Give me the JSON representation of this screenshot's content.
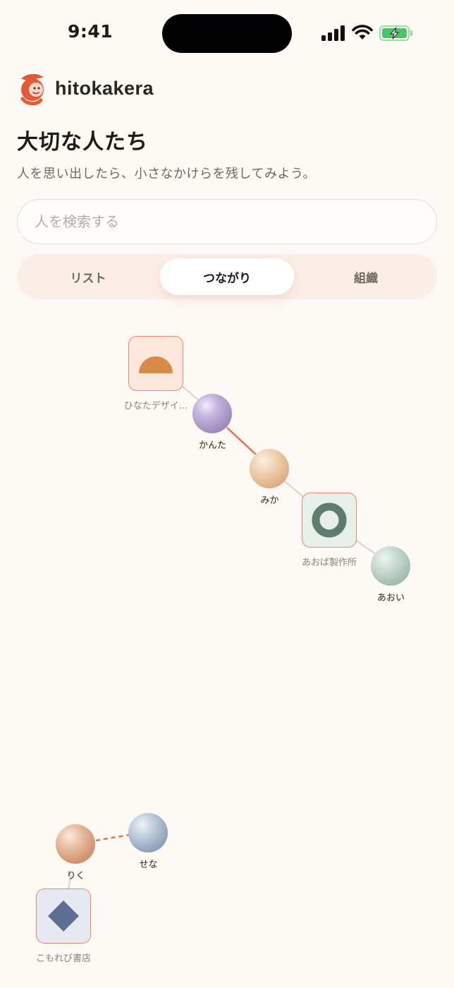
{
  "status_bar": {
    "time": "9:41"
  },
  "header": {
    "brand": "hitokakera",
    "title": "大切な人たち",
    "subtitle": "人を思い出したら、小さなかけらを残してみよう。"
  },
  "search": {
    "placeholder": "人を検索する"
  },
  "tabs": [
    {
      "label": "リスト",
      "active": false
    },
    {
      "label": "つながり",
      "active": true
    },
    {
      "label": "組織",
      "active": false
    }
  ],
  "graph": {
    "orgs": [
      {
        "label": "ひなたデザイ...",
        "icon": "half-circle-icon",
        "color": "#d98b4a",
        "bg": "#fbe7dc"
      },
      {
        "label": "あおば製作所",
        "icon": "ring-icon",
        "color": "#5f7d6c",
        "bg": "#e7efe9"
      },
      {
        "label": "こもれび書店",
        "icon": "diamond-icon",
        "color": "#5d6f92",
        "bg": "#e6e9f1"
      }
    ],
    "people": [
      {
        "label": "かんた",
        "color": "#a897c4"
      },
      {
        "label": "みか",
        "color": "#e3b48c"
      },
      {
        "label": "あおい",
        "color": "#a9c3b8"
      },
      {
        "label": "りく",
        "color": "#d49a78"
      },
      {
        "label": "せな",
        "color": "#97a9c0"
      }
    ],
    "edge_colors": {
      "accent": "#e2704f",
      "neutral": "#d8d2cd"
    }
  }
}
